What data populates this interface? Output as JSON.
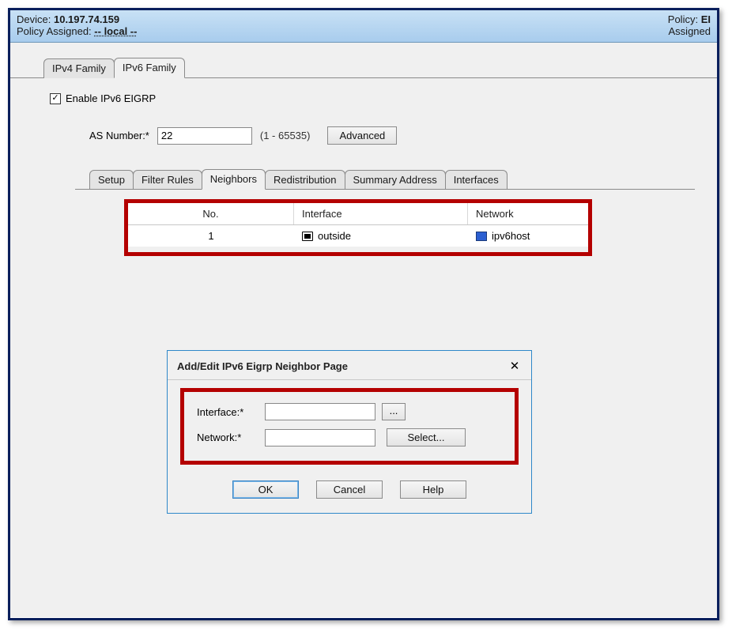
{
  "header": {
    "device_label": "Device:",
    "device_value": "10.197.74.159",
    "policy_assigned_label": "Policy Assigned:",
    "policy_assigned_value": "-- local --",
    "policy_label": "Policy:",
    "policy_value": "EI",
    "assigned_label": "Assigned"
  },
  "outer_tabs": {
    "ipv4": "IPv4 Family",
    "ipv6": "IPv6 Family"
  },
  "enable_label": "Enable IPv6 EIGRP",
  "enable_checked": true,
  "as": {
    "label": "AS Number:*",
    "value": "22",
    "range_hint": "(1 - 65535)",
    "advanced_btn": "Advanced"
  },
  "inner_tabs": {
    "setup": "Setup",
    "filter_rules": "Filter Rules",
    "neighbors": "Neighbors",
    "redistribution": "Redistribution",
    "summary_address": "Summary Address",
    "interfaces": "Interfaces"
  },
  "table": {
    "headers": {
      "no": "No.",
      "interface": "Interface",
      "network": "Network"
    },
    "rows": [
      {
        "no": "1",
        "interface": "outside",
        "network": "ipv6host"
      }
    ]
  },
  "dialog": {
    "title": "Add/Edit IPv6 Eigrp Neighbor Page",
    "interface_label": "Interface:*",
    "interface_value": "",
    "browse_label": "...",
    "network_label": "Network:*",
    "network_value": "",
    "select_label": "Select...",
    "ok": "OK",
    "cancel": "Cancel",
    "help": "Help"
  }
}
